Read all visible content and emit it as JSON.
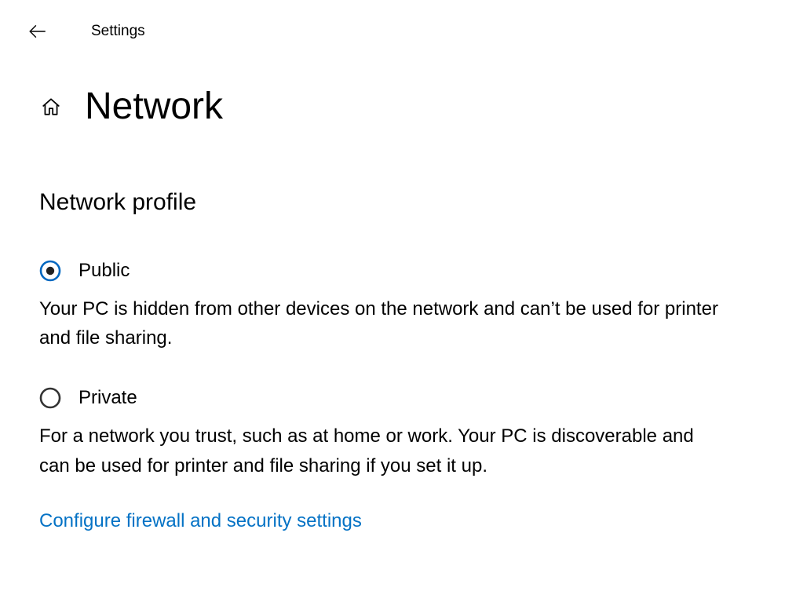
{
  "header": {
    "app_title": "Settings"
  },
  "page": {
    "title": "Network",
    "section_heading": "Network profile"
  },
  "options": {
    "public": {
      "label": "Public",
      "selected": true,
      "description": "Your PC is hidden from other devices on the network and can’t be used for printer and file sharing."
    },
    "private": {
      "label": "Private",
      "selected": false,
      "description": "For a network you trust, such as at home or work. Your PC is discoverable and can be used for printer and file sharing if you set it up."
    }
  },
  "link": {
    "firewall": "Configure firewall and security settings"
  },
  "colors": {
    "accent": "#0067c0",
    "link": "#0472c5"
  }
}
